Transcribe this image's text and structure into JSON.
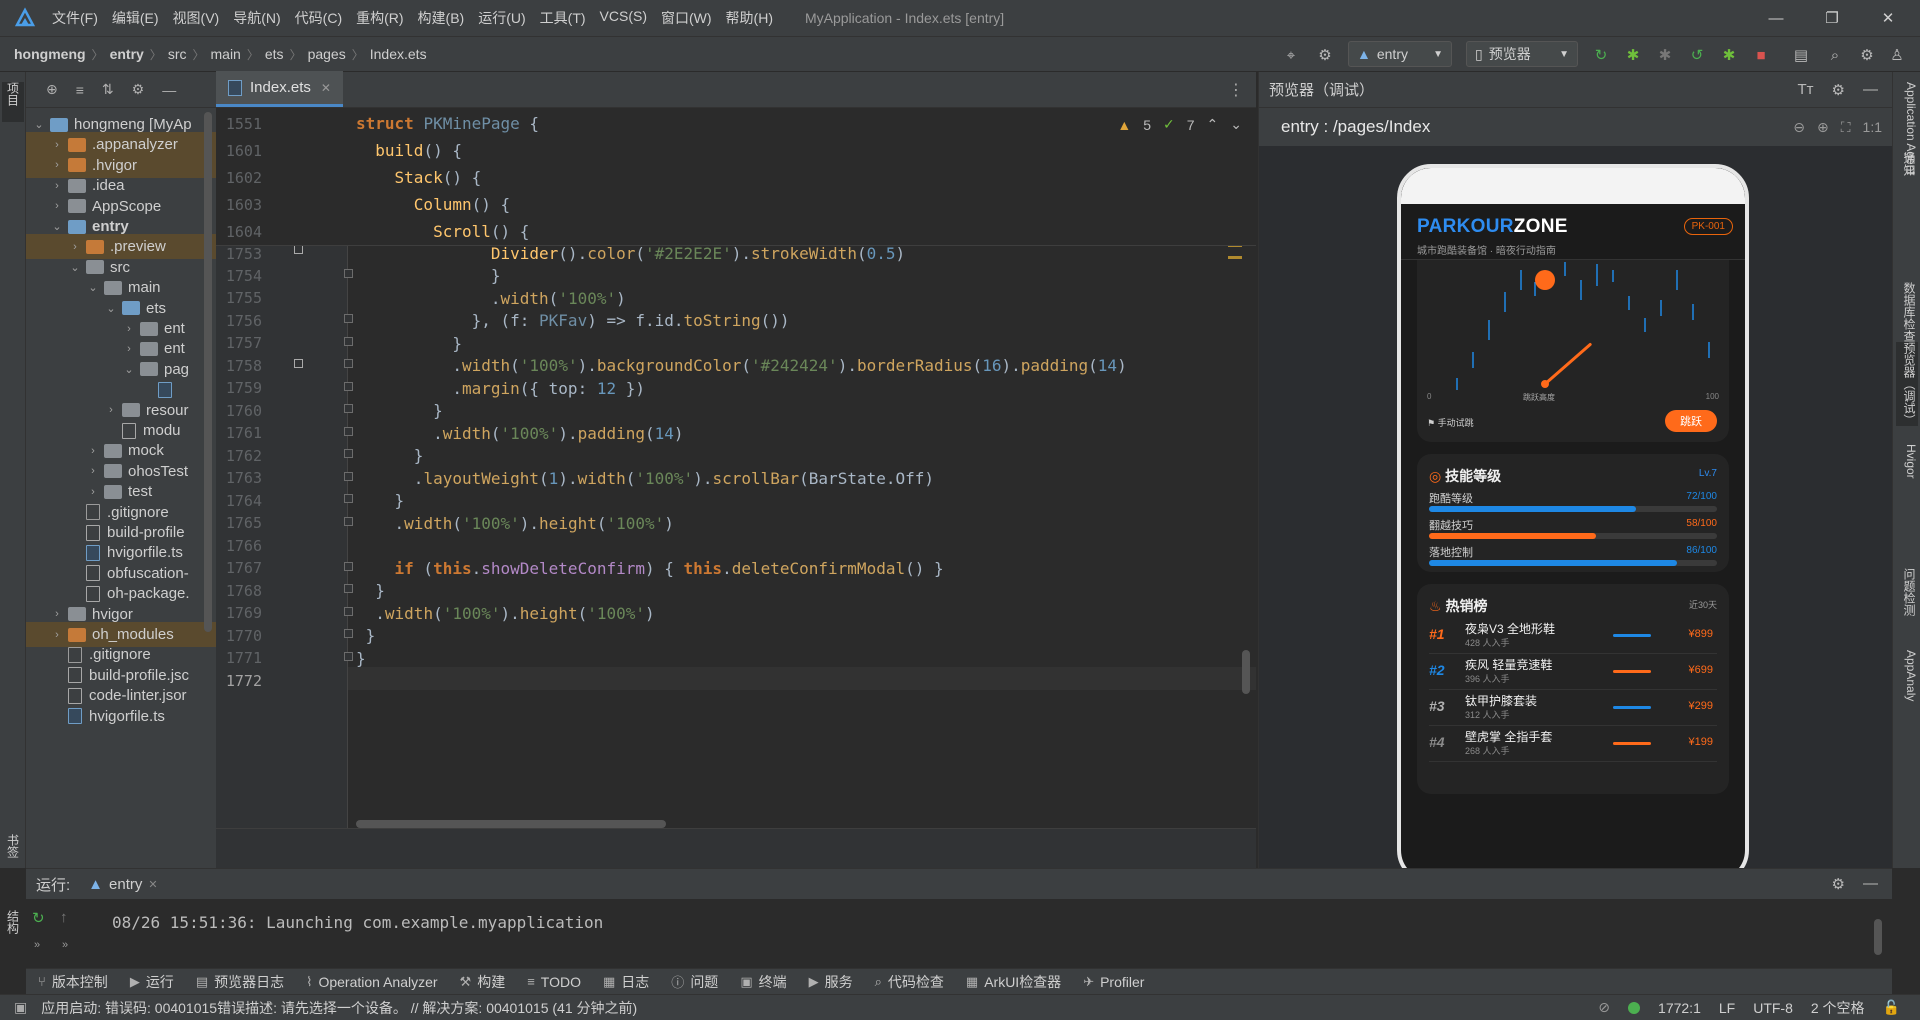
{
  "menubar": {
    "items": [
      "文件(F)",
      "编辑(E)",
      "视图(V)",
      "导航(N)",
      "代码(C)",
      "重构(R)",
      "构建(B)",
      "运行(U)",
      "工具(T)",
      "VCS(S)",
      "窗口(W)",
      "帮助(H)"
    ],
    "window_title": "MyApplication - Index.ets [entry]"
  },
  "breadcrumb": [
    "hongmeng",
    "entry",
    "src",
    "main",
    "ets",
    "pages",
    "Index.ets"
  ],
  "toolbar": {
    "run_config": "entry",
    "device": "预览器"
  },
  "left_strip": {
    "project": "项目",
    "bookmarks": "书签",
    "structure": "结构"
  },
  "project_tree": [
    {
      "label": "hongmeng [MyAp",
      "depth": 0,
      "kind": "folder-blue",
      "open": true
    },
    {
      "label": ".appanalyzer",
      "depth": 1,
      "kind": "folder-orange",
      "open": false,
      "hl": true
    },
    {
      "label": ".hvigor",
      "depth": 1,
      "kind": "folder-orange",
      "open": false,
      "hl": true
    },
    {
      "label": ".idea",
      "depth": 1,
      "kind": "folder-gray",
      "open": false
    },
    {
      "label": "AppScope",
      "depth": 1,
      "kind": "folder-gray",
      "open": false
    },
    {
      "label": "entry",
      "depth": 1,
      "kind": "folder-blue",
      "open": true,
      "bold": true
    },
    {
      "label": ".preview",
      "depth": 2,
      "kind": "folder-orange",
      "open": false,
      "hl": true
    },
    {
      "label": "src",
      "depth": 2,
      "kind": "folder-gray",
      "open": true
    },
    {
      "label": "main",
      "depth": 3,
      "kind": "folder-gray",
      "open": true
    },
    {
      "label": "ets",
      "depth": 4,
      "kind": "folder-blue",
      "open": true
    },
    {
      "label": "ent",
      "depth": 5,
      "kind": "folder-gray",
      "open": false
    },
    {
      "label": "ent",
      "depth": 5,
      "kind": "folder-gray",
      "open": false
    },
    {
      "label": "pag",
      "depth": 5,
      "kind": "folder-gray",
      "open": true
    },
    {
      "label": "",
      "depth": 6,
      "kind": "file-ets",
      "open": null
    },
    {
      "label": "resour",
      "depth": 4,
      "kind": "folder-gray",
      "open": false
    },
    {
      "label": "modu",
      "depth": 4,
      "kind": "file-json",
      "open": null
    },
    {
      "label": "mock",
      "depth": 3,
      "kind": "folder-gray",
      "open": false
    },
    {
      "label": "ohosTest",
      "depth": 3,
      "kind": "folder-gray",
      "open": false
    },
    {
      "label": "test",
      "depth": 3,
      "kind": "folder-gray",
      "open": false
    },
    {
      "label": ".gitignore",
      "depth": 2,
      "kind": "file-git",
      "open": null
    },
    {
      "label": "build-profile",
      "depth": 2,
      "kind": "file-json",
      "open": null
    },
    {
      "label": "hvigorfile.ts",
      "depth": 2,
      "kind": "file-ets",
      "open": null
    },
    {
      "label": "obfuscation-",
      "depth": 2,
      "kind": "file-json",
      "open": null
    },
    {
      "label": "oh-package.",
      "depth": 2,
      "kind": "file-json",
      "open": null
    },
    {
      "label": "hvigor",
      "depth": 1,
      "kind": "folder-gray",
      "open": false
    },
    {
      "label": "oh_modules",
      "depth": 1,
      "kind": "folder-orange",
      "open": false,
      "hl": true
    },
    {
      "label": ".gitignore",
      "depth": 1,
      "kind": "file-git",
      "open": null
    },
    {
      "label": "build-profile.jsc",
      "depth": 1,
      "kind": "file-json",
      "open": null
    },
    {
      "label": "code-linter.jsor",
      "depth": 1,
      "kind": "file-json",
      "open": null
    },
    {
      "label": "hvigorfile.ts",
      "depth": 1,
      "kind": "file-ets",
      "open": null
    }
  ],
  "editor": {
    "tab_label": "Index.ets",
    "inspections": {
      "warnings": "5",
      "weak_warnings": "7"
    },
    "sticky_lines": [
      {
        "num": "1551",
        "html": "<span class=\"kw\">struct</span> <span class=\"ty\">PKMinePage</span> {"
      },
      {
        "num": "1601",
        "html": "  <span class=\"fn\">build</span>() {"
      },
      {
        "num": "1602",
        "html": "    <span class=\"fn\">Stack</span>() {"
      },
      {
        "num": "1603",
        "html": "      <span class=\"fn\">Column</span>() {"
      },
      {
        "num": "1604",
        "html": "        <span class=\"fn\">Scroll</span>() {"
      }
    ],
    "partial_line": {
      "num": "1753",
      "html": "              <span class=\"fn\">Divider</span>().<span class=\"mt\">color</span>(<span class=\"str\">'#2E2E2E'</span>).<span class=\"mt\">strokeWidth</span>(<span class=\"num\">0.5</span>)"
    },
    "lines": [
      {
        "num": "1754",
        "html": "              }"
      },
      {
        "num": "1755",
        "html": "              .<span class=\"mt\">width</span>(<span class=\"str\">'100%'</span>)"
      },
      {
        "num": "1756",
        "html": "            }, (f: <span class=\"ty\">PKFav</span>) => f.id.<span class=\"mt\">toString</span>())"
      },
      {
        "num": "1757",
        "html": "          }"
      },
      {
        "num": "1758",
        "html": "          .<span class=\"mt\">width</span>(<span class=\"str\">'100%'</span>).<span class=\"mt\">backgroundColor</span>(<span class=\"str\">'#242424'</span>).<span class=\"mt\">borderRadius</span>(<span class=\"num\">16</span>).<span class=\"mt\">padding</span>(<span class=\"num\">14</span>)"
      },
      {
        "num": "1759",
        "html": "          .<span class=\"mt\">margin</span>({ top: <span class=\"num\">12</span> })"
      },
      {
        "num": "1760",
        "html": "        }"
      },
      {
        "num": "1761",
        "html": "        .<span class=\"mt\">width</span>(<span class=\"str\">'100%'</span>).<span class=\"mt\">padding</span>(<span class=\"num\">14</span>)"
      },
      {
        "num": "1762",
        "html": "      }"
      },
      {
        "num": "1763",
        "html": "      .<span class=\"mt\">layoutWeight</span>(<span class=\"num\">1</span>).<span class=\"mt\">width</span>(<span class=\"str\">'100%'</span>).<span class=\"mt\">scrollBar</span>(BarState.Off)"
      },
      {
        "num": "1764",
        "html": "    }"
      },
      {
        "num": "1765",
        "html": "    .<span class=\"mt\">width</span>(<span class=\"str\">'100%'</span>).<span class=\"mt\">height</span>(<span class=\"str\">'100%'</span>)"
      },
      {
        "num": "1766",
        "html": ""
      },
      {
        "num": "1767",
        "html": "    <span class=\"kw\">if</span> (<span class=\"kw\">this</span>.<span class=\"prop\">showDeleteConfirm</span>) { <span class=\"kw\">this</span>.<span class=\"mt\">deleteConfirmModal</span>() }"
      },
      {
        "num": "1768",
        "html": "  }"
      },
      {
        "num": "1769",
        "html": "  .<span class=\"mt\">width</span>(<span class=\"str\">'100%'</span>).<span class=\"mt\">height</span>(<span class=\"str\">'100%'</span>)"
      },
      {
        "num": "1770",
        "html": " }"
      },
      {
        "num": "1771",
        "html": "}"
      },
      {
        "num": "1772",
        "html": ""
      }
    ]
  },
  "previewer": {
    "title": "预览器（调试）",
    "path": "entry : /pages/Index",
    "zoom_label": "1:1",
    "app": {
      "brand_a": "PARKOUR",
      "brand_b": "ZONE",
      "subtitle": "城市跑酷装备馆 · 暗夜行动指南",
      "badge": "PK-001",
      "gauge": {
        "min": "0",
        "max": "100",
        "label": "跳跃高度",
        "level": 0.62
      },
      "manual_label": "手动试跳",
      "jump_button": "跳跃",
      "skills": {
        "title": "技能等级",
        "level": "Lv.7",
        "items": [
          {
            "name": "跑酷等级",
            "value": "72/100",
            "fraction": 0.72,
            "color": "#1e88e5"
          },
          {
            "name": "翻越技巧",
            "value": "58/100",
            "fraction": 0.58,
            "color": "#ff6a1a"
          },
          {
            "name": "落地控制",
            "value": "86/100",
            "fraction": 0.86,
            "color": "#1e88e5"
          }
        ]
      },
      "hot": {
        "title": "热销榜",
        "period": "近30天",
        "items": [
          {
            "rank": "#1",
            "name": "夜枭V3 全地形鞋",
            "sub": "428 人入手",
            "price": "¥899",
            "rank_color": "#ff6a1a",
            "line_color": "#1e88e5"
          },
          {
            "rank": "#2",
            "name": "疾风 轻量竞速鞋",
            "sub": "396 人入手",
            "price": "¥699",
            "rank_color": "#1e88e5",
            "line_color": "#ff6a1a"
          },
          {
            "rank": "#3",
            "name": "钛甲护膝套装",
            "sub": "312 人入手",
            "price": "¥299",
            "rank_color": "#b0b0b0",
            "line_color": "#1e88e5"
          },
          {
            "rank": "#4",
            "name": "壁虎掌 全指手套",
            "sub": "268 人入手",
            "price": "¥199",
            "rank_color": "#8a8a8a",
            "line_color": "#ff6a1a"
          }
        ]
      }
    }
  },
  "right_strip": [
    "Application Agent",
    "通知",
    "数据库检查器",
    "预览器（调试）",
    "Hvigor",
    "问题检测",
    "AppAnaly"
  ],
  "run_panel": {
    "label": "运行:",
    "tab": "entry",
    "output": "08/26 15:51:36: Launching com.example.myapplication"
  },
  "tool_windows": [
    "版本控制",
    "运行",
    "预览器日志",
    "Operation Analyzer",
    "构建",
    "TODO",
    "日志",
    "问题",
    "终端",
    "服务",
    "代码检查",
    "ArkUI检查器",
    "Profiler"
  ],
  "status": {
    "message": "应用启动: 错误码: 00401015错误描述: 请先选择一个设备。 // 解决方案: 00401015 (41 分钟之前)",
    "position": "1772:1",
    "line_sep": "LF",
    "encoding": "UTF-8",
    "indent": "2 个空格"
  },
  "colors": {
    "accent_orange": "#ff6a1a",
    "accent_blue": "#2e8cf0"
  }
}
